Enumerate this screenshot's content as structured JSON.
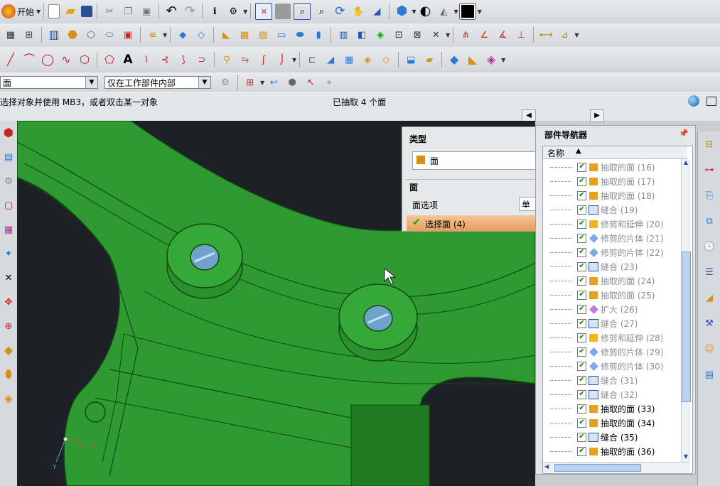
{
  "app": {
    "start_label": "开始",
    "accent": "#2fa32f"
  },
  "toolbar": {
    "row1": [
      "new-file-icon",
      "open-folder-icon",
      "save-icon",
      "cut-icon",
      "copy-icon",
      "paste-icon",
      "undo-icon",
      "redo-icon",
      "information-icon",
      "view-options-icon",
      "fit-icon",
      "shade-icon",
      "zoom-area-icon",
      "zoom-icon",
      "rotate-icon",
      "pan-icon",
      "perspective-icon",
      "view-cube-icon",
      "render-style-icon",
      "layer-icon",
      "color-swatch-icon"
    ],
    "row2": [
      "extrude-icon",
      "sketch-icon",
      "block-icon",
      "cylinder-icon",
      "feature-icon",
      "datum-icon",
      "edge-blend-icon",
      "chamfer-icon",
      "shell-icon",
      "hole-icon",
      "boss-icon",
      "pocket-icon",
      "pad-icon",
      "slot-icon",
      "groove-icon",
      "unite-icon",
      "subtract-icon",
      "intersect-icon",
      "trim-icon",
      "axis-icon",
      "measure-icon",
      "ruler-icon",
      "analysis-icon"
    ],
    "row3": [
      "line-icon",
      "arc-icon",
      "circle-icon",
      "spline-icon",
      "polygon-icon",
      "ellipse-icon",
      "text-icon",
      "curve-icon",
      "offset-curve-icon",
      "bridge-icon",
      "join-icon",
      "project-icon",
      "divide-icon",
      "surface-icon",
      "ruled-icon",
      "through-curves-icon",
      "sweep-icon",
      "bounded-plane-icon",
      "trim-body-icon",
      "extend-icon"
    ]
  },
  "selection": {
    "filter_value": "面",
    "scope_value": "仅在工作部件内部"
  },
  "status": {
    "prompt": "选择对象并使用 MB3，或者双击某一对象",
    "message": "已抽取 4 个面"
  },
  "dialog": {
    "type_header": "类型",
    "type_value": "面",
    "face_header": "面",
    "face_option_label": "面选项",
    "face_option_value": "单个",
    "select_face_label": "选择面 (4)"
  },
  "navigator": {
    "title": "部件导航器",
    "column": "名称",
    "items": [
      {
        "label": "抽取的面 (16)",
        "icon": "extract-face-icon",
        "active": false
      },
      {
        "label": "抽取的面 (17)",
        "icon": "extract-face-icon",
        "active": false
      },
      {
        "label": "抽取的面 (18)",
        "icon": "extract-face-icon",
        "active": false
      },
      {
        "label": "缝合 (19)",
        "icon": "sew-icon",
        "active": false
      },
      {
        "label": "修剪和延伸 (20)",
        "icon": "trim-extend-icon",
        "active": false
      },
      {
        "label": "修剪的片体 (21)",
        "icon": "trimmed-sheet-icon",
        "active": false
      },
      {
        "label": "修剪的片体 (22)",
        "icon": "trimmed-sheet-icon",
        "active": false
      },
      {
        "label": "缝合 (23)",
        "icon": "sew-icon",
        "active": false
      },
      {
        "label": "抽取的面 (24)",
        "icon": "extract-face-icon",
        "active": false
      },
      {
        "label": "抽取的面 (25)",
        "icon": "extract-face-icon",
        "active": false
      },
      {
        "label": "扩大 (26)",
        "icon": "enlarge-icon",
        "active": false
      },
      {
        "label": "缝合 (27)",
        "icon": "sew-icon",
        "active": false
      },
      {
        "label": "修剪和延伸 (28)",
        "icon": "trim-extend-icon",
        "active": false
      },
      {
        "label": "修剪的片体 (29)",
        "icon": "trimmed-sheet-icon",
        "active": false
      },
      {
        "label": "修剪的片体 (30)",
        "icon": "trimmed-sheet-icon",
        "active": false
      },
      {
        "label": "缝合 (31)",
        "icon": "sew-icon",
        "active": false
      },
      {
        "label": "缝合 (32)",
        "icon": "sew-icon",
        "active": false
      },
      {
        "label": "抽取的面 (33)",
        "icon": "extract-face-icon",
        "active": true
      },
      {
        "label": "抽取的面 (34)",
        "icon": "extract-face-icon",
        "active": true
      },
      {
        "label": "缝合 (35)",
        "icon": "sew-icon",
        "active": true
      },
      {
        "label": "抽取的面 (36)",
        "icon": "extract-face-icon",
        "active": true
      }
    ]
  },
  "triad": {
    "x_label": "X",
    "y_label": "Y"
  }
}
